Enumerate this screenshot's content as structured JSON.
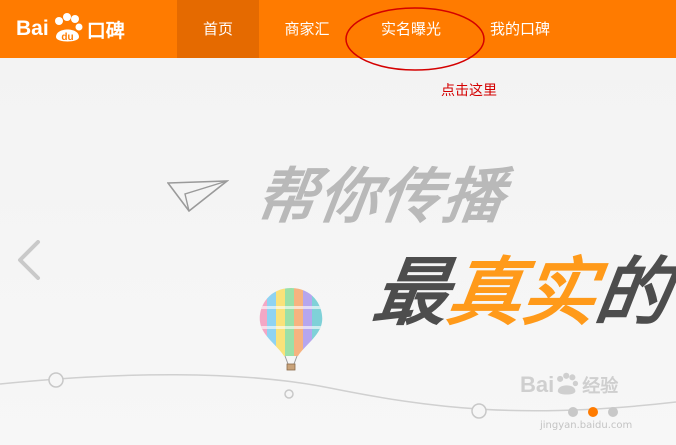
{
  "brand": {
    "latin": "Bai",
    "du": "du",
    "cn": "口碑"
  },
  "nav": {
    "items": [
      {
        "label": "首页",
        "active": true
      },
      {
        "label": "商家汇",
        "active": false
      },
      {
        "label": "实名曝光",
        "active": false
      },
      {
        "label": "我的口碑",
        "active": false
      }
    ]
  },
  "annotation": {
    "text": "点击这里"
  },
  "hero": {
    "line1": "帮你传播",
    "line2_dark_a": "最",
    "line2_orange": "真实",
    "line2_dark_b": "的"
  },
  "carousel": {
    "slides": 3,
    "active_index": 1
  },
  "watermark": {
    "brand": "Bai",
    "brand2": "经验",
    "url": "jingyan.baidu.com"
  },
  "colors": {
    "brand": "#ff7b00",
    "active_nav": "#e56a00",
    "annotation": "#d40000"
  }
}
